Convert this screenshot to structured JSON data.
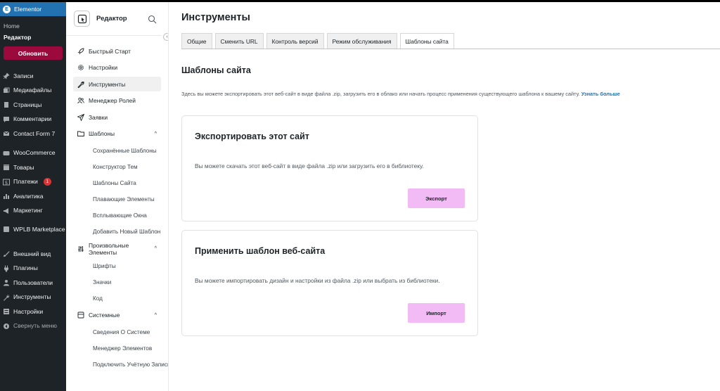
{
  "wp_sidebar": {
    "brand": "Elementor",
    "submenu": [
      {
        "label": "Home",
        "current": false
      },
      {
        "label": "Редактор",
        "current": true
      }
    ],
    "update_button": "Обновить",
    "menu": [
      {
        "label": "Записи",
        "icon": "pin-icon"
      },
      {
        "label": "Медиафайлы",
        "icon": "media-icon"
      },
      {
        "label": "Страницы",
        "icon": "pages-icon"
      },
      {
        "label": "Комментарии",
        "icon": "comments-icon"
      },
      {
        "label": "Contact Form 7",
        "icon": "mail-icon"
      },
      {
        "label": "WooCommerce",
        "icon": "woocommerce-icon"
      },
      {
        "label": "Товары",
        "icon": "products-icon"
      },
      {
        "label": "Платежи",
        "icon": "payments-icon",
        "badge": "1"
      },
      {
        "label": "Аналитика",
        "icon": "analytics-icon"
      },
      {
        "label": "Маркетинг",
        "icon": "megaphone-icon"
      },
      {
        "label": "WPLB Marketplace",
        "icon": "marketplace-icon"
      },
      {
        "label": "Внешний вид",
        "icon": "brush-icon"
      },
      {
        "label": "Плагины",
        "icon": "plugins-icon"
      },
      {
        "label": "Пользователи",
        "icon": "users-icon"
      },
      {
        "label": "Инструменты",
        "icon": "wrench-icon"
      },
      {
        "label": "Настройки",
        "icon": "settings-icon"
      },
      {
        "label": "Свернуть меню",
        "icon": "collapse-icon"
      }
    ]
  },
  "elementor_sidebar": {
    "title": "Редактор",
    "nav": [
      {
        "label": "Быстрый Старт",
        "icon": "rocket-icon"
      },
      {
        "label": "Настройки",
        "icon": "gear-icon"
      },
      {
        "label": "Инструменты",
        "icon": "wrench-icon",
        "active": true
      },
      {
        "label": "Менеджер Ролей",
        "icon": "users-icon"
      },
      {
        "label": "Заявки",
        "icon": "send-icon"
      },
      {
        "label": "Шаблоны",
        "icon": "folder-icon",
        "expanded": true,
        "children": [
          "Сохранённые Шаблоны",
          "Конструктор Тем",
          "Шаблоны Сайта",
          "Плавающие Элементы",
          "Всплывающие Окна",
          "Добавить Новый Шаблон"
        ]
      },
      {
        "label": "Произвольные Элементы",
        "icon": "sliders-icon",
        "expanded": true,
        "children": [
          "Шрифты",
          "Значки",
          "Код"
        ]
      },
      {
        "label": "Системные",
        "icon": "system-icon",
        "expanded": true,
        "children": [
          "Сведения О Системе",
          "Менеджер Элементов",
          "Подключить Учётную Запись"
        ]
      }
    ]
  },
  "main": {
    "title": "Инструменты",
    "tabs": [
      "Общие",
      "Сменить URL",
      "Контроль версий",
      "Режим обслуживания",
      "Шаблоны сайта"
    ],
    "active_tab": "Шаблоны сайта",
    "section_title": "Шаблоны сайта",
    "description": "Здесь вы можете экспортировать этот веб-сайт в виде файла .zip, загрузить его в облако или начать процесс применения существующего шаблона к вашему сайту.",
    "learn_more": "Узнать больше",
    "export_card": {
      "title": "Экспортировать этот сайт",
      "text": "Вы можете скачать этот веб-сайт в виде файла .zip или загрузить его в библиотеку.",
      "button": "Экспорт"
    },
    "import_card": {
      "title": "Применить шаблон веб-сайта",
      "text": "Вы можете импортировать дизайн и настройки из файла .zip или выбрать из библиотеки.",
      "button": "Импорт"
    }
  },
  "colors": {
    "wp_sidebar_bg": "#1d2327",
    "wp_brand_bg": "#2271b1",
    "update_button_bg": "#9c0a3d",
    "card_button_bg": "#f3bbf5",
    "link": "#2271b1",
    "badge": "#d63638"
  }
}
